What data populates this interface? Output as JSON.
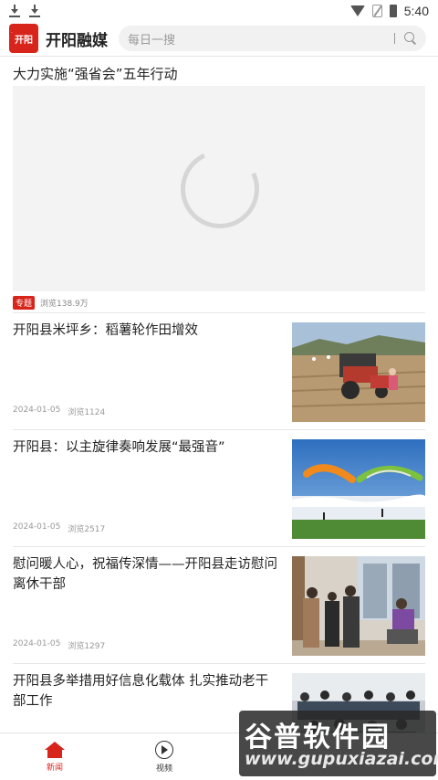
{
  "status_bar": {
    "time": "5:40"
  },
  "header": {
    "app_title": "开阳融媒",
    "logo_text": "开阳",
    "search_placeholder": "每日一搜"
  },
  "feature": {
    "title": "大力实施“强省会”五年行动",
    "tag": "专题",
    "views": "浏览138.9万"
  },
  "news": [
    {
      "title": "开阳县米坪乡：稻薯轮作田增效",
      "date": "2024-01-05",
      "views": "浏览1124"
    },
    {
      "title": "开阳县：以主旋律奏响发展“最强音”",
      "date": "2024-01-05",
      "views": "浏览2517"
    },
    {
      "title": "慰问暖人心，祝福传深情——开阳县走访慰问离休干部",
      "date": "2024-01-05",
      "views": "浏览1297"
    },
    {
      "title": "开阳县多举措用好信息化载体 扎实推动老干部工作"
    }
  ],
  "bottom_nav": {
    "items": [
      {
        "label": "新闻",
        "icon": "home-icon",
        "active": true
      },
      {
        "label": "视频",
        "icon": "play-circle-icon",
        "active": false
      }
    ]
  },
  "watermark": {
    "title": "谷普软件园",
    "url": "www.gupuxiazai.com"
  },
  "colors": {
    "accent": "#d8251c",
    "divider": "#e6e6e6",
    "meta": "#999999"
  }
}
